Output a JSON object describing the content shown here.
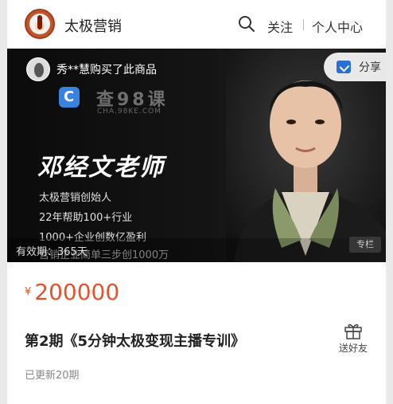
{
  "header": {
    "shop_name": "太极营销",
    "search_icon": "search-icon",
    "follow_label": "关注",
    "user_center_label": "个人中心"
  },
  "banner": {
    "buyer_notice": "秀**慧购买了此商品",
    "share_label": "分享",
    "watermark": "查98课",
    "watermark_sub": "CHA.98KE.COM",
    "teacher_name": "邓经文老师",
    "lines": [
      "太极营销创始人",
      "22年帮助100+行业",
      "1000+企业创数亿盈利",
      "营销企业简单三步创1000万"
    ],
    "validity": "有效期：365天",
    "type_tag": "专栏"
  },
  "product": {
    "currency": "¥",
    "price": "200000",
    "title": "第2期《5分钟太极变现主播专训》",
    "gift_label": "送好友",
    "updated": "已更新20期"
  },
  "colors": {
    "price": "#e4532d",
    "share_icon": "#2a6fd1"
  }
}
